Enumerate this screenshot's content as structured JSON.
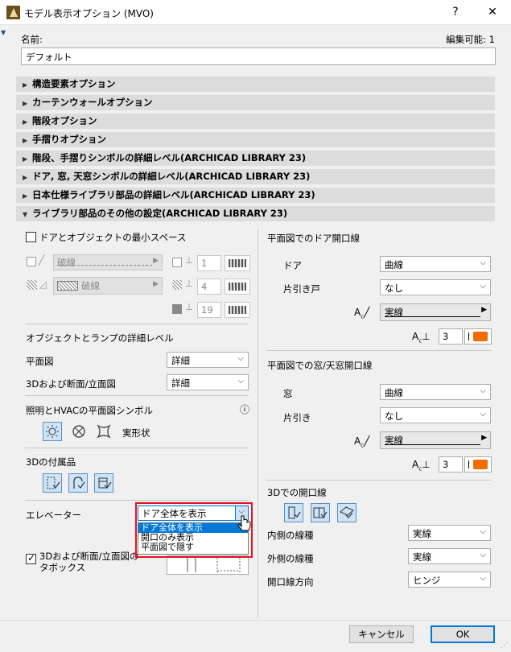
{
  "window": {
    "title": "モデル表示オプション (MVO)",
    "help_label": "?",
    "close_label": "✕"
  },
  "name_row": {
    "label": "名前:",
    "edit_label": "編集可能: 1",
    "value": "デフォルト"
  },
  "sections": [
    {
      "label": "構造要素オプション",
      "expanded": false
    },
    {
      "label": "カーテンウォールオプション",
      "expanded": false
    },
    {
      "label": "階段オプション",
      "expanded": false
    },
    {
      "label": "手摺りオプション",
      "expanded": false
    },
    {
      "label": "階段、手摺りシンボルの詳細レベル(ARCHICAD LIBRARY 23)",
      "expanded": false
    },
    {
      "label": "ドア, 窓, 天窓シンボルの詳細レベル(ARCHICAD LIBRARY 23)",
      "expanded": false
    },
    {
      "label": "日本仕様ライブラリ部品の詳細レベル(ARCHICAD LIBRARY 23)",
      "expanded": false
    },
    {
      "label": "ライブラリ部品のその他の設定(ARCHICAD LIBRARY 23)",
      "expanded": true
    }
  ],
  "left": {
    "min_space_label": "ドアとオブジェクトの最小スペース",
    "min_space_checked": false,
    "line_type_value": "破線",
    "fill_value": "破線",
    "pen1": "1",
    "pen2": "4",
    "pen3": "19",
    "detail_title": "オブジェクトとランプの詳細レベル",
    "plan_label": "平面図",
    "plan_value": "詳細",
    "section_label": "3Dおよび断面/立面図",
    "section_value": "詳細",
    "lighting_title": "照明とHVACの平面図シンボル",
    "info_icon": "ⓘ",
    "real_shape_label": "実形状",
    "accessories_title": "3Dの付属品",
    "elevator_label": "エレベーター",
    "elevator_value": "ドア全体を表示",
    "elevator_options": [
      "ドア全体を表示",
      "開口のみ表示",
      "平面図で隠す"
    ],
    "door_section_line1": "3Dおよび断面/立面図の",
    "door_section_line2": "タボックス",
    "door_section_checked": true
  },
  "right": {
    "door_open_title": "平面図でのドア開口線",
    "door_label": "ドア",
    "door_value": "曲線",
    "sliding_door_label": "片引き戸",
    "sliding_door_value": "なし",
    "door_line_type": "実線",
    "door_pen": "3",
    "window_open_title": "平面図での窓/天窓開口線",
    "window_label": "窓",
    "window_value": "曲線",
    "sliding_window_label": "片引き",
    "sliding_window_value": "なし",
    "window_line_type": "実線",
    "window_pen": "3",
    "open3d_title": "3Dでの開口線",
    "inner_label": "内側の線種",
    "inner_value": "実線",
    "outer_label": "外側の線種",
    "outer_value": "実線",
    "direction_label": "開口線方向",
    "direction_value": "ヒンジ"
  },
  "footer": {
    "cancel_label": "キャンセル",
    "ok_label": "OK"
  },
  "colors": {
    "accent": "#0078d7",
    "pen_orange": "#f26d00",
    "highlight_box": "#e81123",
    "section_bg": "#dcdcdc"
  }
}
